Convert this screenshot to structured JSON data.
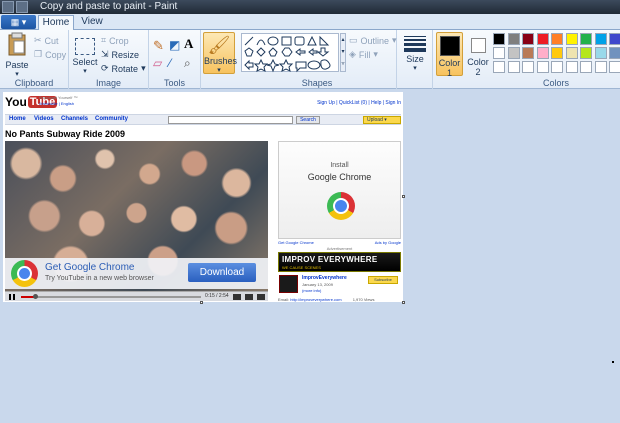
{
  "window": {
    "title": "Copy and paste to paint - Paint"
  },
  "ribbon_tabs": {
    "file": "▦ ▾",
    "home": "Home",
    "view": "View"
  },
  "clipboard": {
    "paste": "Paste",
    "cut": "Cut",
    "copy": "Copy",
    "label": "Clipboard"
  },
  "image": {
    "select": "Select",
    "crop": "Crop",
    "resize": "Resize",
    "rotate": "Rotate",
    "label": "Image"
  },
  "tools": {
    "label": "Tools"
  },
  "brushes": {
    "label": "Brushes"
  },
  "shapes": {
    "outline": "Outline",
    "fill": "Fill",
    "label": "Shapes"
  },
  "size": {
    "label": "Size"
  },
  "color1": {
    "label": "Color",
    "index": "1",
    "value": "#000000"
  },
  "color2": {
    "label": "Color",
    "index": "2",
    "value": "#ffffff"
  },
  "colors": {
    "label": "Colors",
    "row1": [
      "#000000",
      "#7f7f7f",
      "#880015",
      "#ed1c24",
      "#ff7f27",
      "#fff200",
      "#22b14c",
      "#00a2e8",
      "#3f48cc",
      "#a349a4"
    ],
    "row2": [
      "#ffffff",
      "#c3c3c3",
      "#b97a57",
      "#ffaec9",
      "#ffc90e",
      "#efe4b0",
      "#b5e61d",
      "#99d9ea",
      "#7092be",
      "#c8bfe7"
    ],
    "row3": [
      "#ffffff",
      "#ffffff",
      "#ffffff",
      "#ffffff",
      "#ffffff",
      "#ffffff",
      "#ffffff",
      "#ffffff",
      "#ffffff",
      "#ffffff"
    ]
  },
  "youtube": {
    "logo_you": "You",
    "logo_tube": "Tube",
    "sub1": "Broadcast Yourself ™",
    "sub2": "Worldwide | English",
    "links": "Sign Up | QuickList (0) | Help | Sign In",
    "nav": [
      "Home",
      "Videos",
      "Channels",
      "Community"
    ],
    "search_button": "Search",
    "upload": "Upload ▾",
    "video_title": "No Pants Subway Ride 2009",
    "ad_title": "Get Google Chrome",
    "ad_sub": "Try YouTube in a new web browser",
    "download": "Download",
    "time": "0:15 / 2:54",
    "side_install": "Install",
    "side_chrome": "Google Chrome",
    "side_left_link": "Get Google Chrome",
    "side_right_link": "Ads by Google",
    "advertisement": "Advertisement",
    "improv_title": "IMPROV EVERYWHERE",
    "improv_sub": "WE CAUSE SCENES",
    "channel_name": "ImprovEverywhere",
    "channel_date": "January 13, 2009",
    "channel_more": "(more info)",
    "subscribe": "Subscribe",
    "embed_text": "Email: ",
    "embed_link": "http://improveverywhere.com",
    "views": "1,970 Views"
  }
}
